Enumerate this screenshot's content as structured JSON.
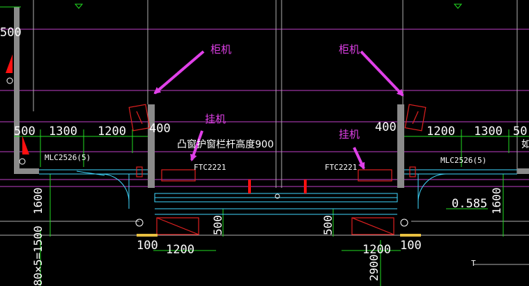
{
  "annotations": {
    "cabinet_left": "柜机",
    "cabinet_right": "柜机",
    "wall_left": "挂机",
    "wall_right": "挂机"
  },
  "dimensions": {
    "top_left_partial": "500",
    "left_500": "500",
    "left_1300": "1300",
    "left_1200": "1200",
    "left_400": "400",
    "right_400": "400",
    "right_1200": "1200",
    "right_1300": "1300",
    "right_partial": "50",
    "v_1600_left": "1600",
    "v_1600_right": "1600",
    "v_500_mid_left": "500",
    "v_500_mid_right": "500",
    "bottom_100_left": "100",
    "bottom_100_right": "100",
    "bottom_1200_left": "1200",
    "bottom_1200_right": "1200",
    "bottom_2900": "2900",
    "left_stack_formula": "80×5=1500",
    "level_0585": "0.585"
  },
  "labels": {
    "mlc_left": "MLC2526(5)",
    "mlc_right": "MLC2526(5)",
    "ftc_left": "FTC2221",
    "ftc_right": "FTC2221",
    "bay_window_note": "凸窗护窗栏杆高度900",
    "edge_char": "如",
    "t_mark": "T"
  },
  "colors": {
    "annotation": "#e040e8",
    "wall": "#8a8a8a",
    "gridline": "#e040e8",
    "dim_line": "#22dd22",
    "equipment": "#e02020",
    "window": "#40d8ff",
    "text": "#ffffff"
  }
}
